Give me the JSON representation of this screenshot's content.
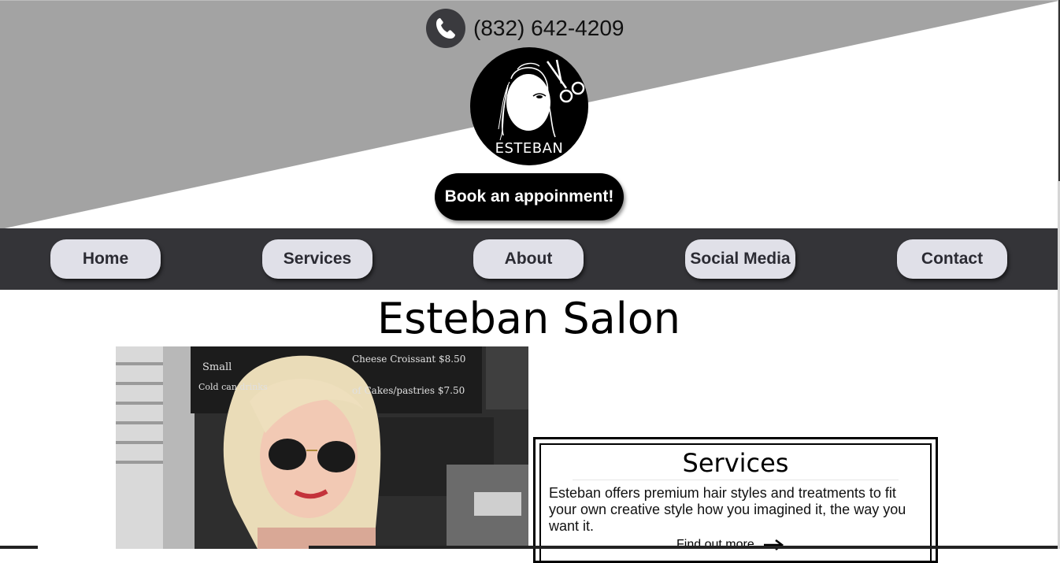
{
  "header": {
    "phone_icon": "phone-icon",
    "phone": "(832) 642-4209",
    "logo_text": "ESTEBAN",
    "book_button": "Book an appoinment!"
  },
  "nav": {
    "items": [
      {
        "label": "Home"
      },
      {
        "label": "Services"
      },
      {
        "label": "About"
      },
      {
        "label": "Social Media"
      },
      {
        "label": "Contact"
      }
    ]
  },
  "main": {
    "title": "Esteban Salon",
    "services": {
      "heading": "Services",
      "text": "Esteban offers premium hair styles and treatments to fit your own creative style how you imagined it, the way you want it.",
      "link": "Find out more"
    }
  },
  "colors": {
    "hero_gray": "#a3a3a3",
    "nav_bg": "#343438",
    "nav_button": "#e0e0e8",
    "book_button": "#000000"
  }
}
